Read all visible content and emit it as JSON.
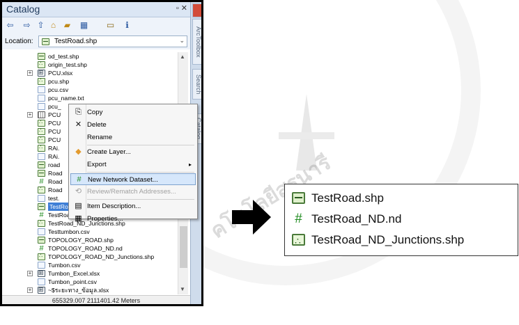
{
  "watermark": {
    "text": "คโนโลยีสุรนารี"
  },
  "catalog": {
    "title": "Catalog",
    "window_controls": "▫ ✕",
    "toolbar_icons": [
      "back-icon",
      "forward-icon",
      "up-one-level-icon",
      "home-icon",
      "connect-folder-icon",
      "view-menu-icon",
      "toggle-contents-icon",
      "search-window-icon"
    ],
    "location_label": "Location:",
    "location_value": "TestRoad.shp",
    "side_tabs": [
      "ArcToolbox",
      "Search",
      "Catalog"
    ],
    "tree": [
      {
        "label": "od_test.shp",
        "icon": "line",
        "expander": ""
      },
      {
        "label": "origin_test.shp",
        "icon": "point",
        "expander": ""
      },
      {
        "label": "PCU.xlsx",
        "icon": "table",
        "expander": "+"
      },
      {
        "label": "pcu.shp",
        "icon": "point",
        "expander": ""
      },
      {
        "label": "pcu.csv",
        "icon": "doc",
        "expander": ""
      },
      {
        "label": "pcu_name.txt",
        "icon": "doc",
        "expander": ""
      },
      {
        "label": "pcu_",
        "icon": "doc",
        "expander": ""
      },
      {
        "label": "PCU",
        "icon": "grid",
        "expander": "+"
      },
      {
        "label": "PCU",
        "icon": "point",
        "expander": ""
      },
      {
        "label": "PCU",
        "icon": "point",
        "expander": ""
      },
      {
        "label": "PCU",
        "icon": "point",
        "expander": ""
      },
      {
        "label": "RAi.",
        "icon": "point",
        "expander": ""
      },
      {
        "label": "RAi.",
        "icon": "doc",
        "expander": ""
      },
      {
        "label": "road",
        "icon": "line",
        "expander": ""
      },
      {
        "label": "Road",
        "icon": "line",
        "expander": ""
      },
      {
        "label": "Road",
        "icon": "network",
        "expander": ""
      },
      {
        "label": "Road",
        "icon": "point",
        "expander": ""
      },
      {
        "label": "test.",
        "icon": "doc",
        "expander": ""
      },
      {
        "label": "TestRoad.shp",
        "icon": "line",
        "expander": "",
        "selected": true
      },
      {
        "label": "TestRoad_ND.nd",
        "icon": "network",
        "expander": ""
      },
      {
        "label": "TestRoad_ND_Junctions.shp",
        "icon": "point",
        "expander": ""
      },
      {
        "label": "Testtumbon.csv",
        "icon": "doc",
        "expander": ""
      },
      {
        "label": "TOPOLOGY_ROAD.shp",
        "icon": "line",
        "expander": ""
      },
      {
        "label": "TOPOLOGY_ROAD_ND.nd",
        "icon": "network",
        "expander": ""
      },
      {
        "label": "TOPOLOGY_ROAD_ND_Junctions.shp",
        "icon": "point",
        "expander": ""
      },
      {
        "label": "Tumbon.csv",
        "icon": "doc",
        "expander": ""
      },
      {
        "label": "Tumbon_Excel.xlsx",
        "icon": "table",
        "expander": "+"
      },
      {
        "label": "Tumbon_point.csv",
        "icon": "doc",
        "expander": ""
      },
      {
        "label": "~$ระยะทาง_ข้อมูล.xlsx",
        "icon": "table",
        "expander": "+"
      }
    ],
    "status": "655329.007  2111401.42 Meters"
  },
  "context_menu": {
    "items": [
      {
        "label": "Copy",
        "icon": "copy-icon",
        "glyph": "⎘"
      },
      {
        "label": "Delete",
        "icon": "delete-icon",
        "glyph": "✕"
      },
      {
        "label": "Rename",
        "icon": "",
        "glyph": ""
      },
      {
        "label": "Create Layer...",
        "icon": "create-layer-icon",
        "glyph": "◆"
      },
      {
        "label": "Export",
        "icon": "",
        "glyph": "",
        "submenu": "▸"
      },
      {
        "label": "New Network Dataset...",
        "icon": "network-dataset-icon",
        "glyph": "#",
        "hover": true
      },
      {
        "label": "Review/Rematch Addresses...",
        "icon": "review-rematch-icon",
        "glyph": "⟲",
        "disabled": true
      },
      {
        "label": "Item Description...",
        "icon": "item-description-icon",
        "glyph": "▤"
      },
      {
        "label": "Properties...",
        "icon": "properties-icon",
        "glyph": "▦"
      }
    ]
  },
  "zoom": {
    "items": [
      {
        "label": "TestRoad.shp",
        "icon": "line"
      },
      {
        "label": "TestRoad_ND.nd",
        "icon": "network"
      },
      {
        "label": "TestRoad_ND_Junctions.shp",
        "icon": "point"
      }
    ]
  },
  "colors": {
    "selection": "#3f7fd6",
    "menu_hover": "#d6e7fb",
    "network_green": "#1d8a1d"
  }
}
